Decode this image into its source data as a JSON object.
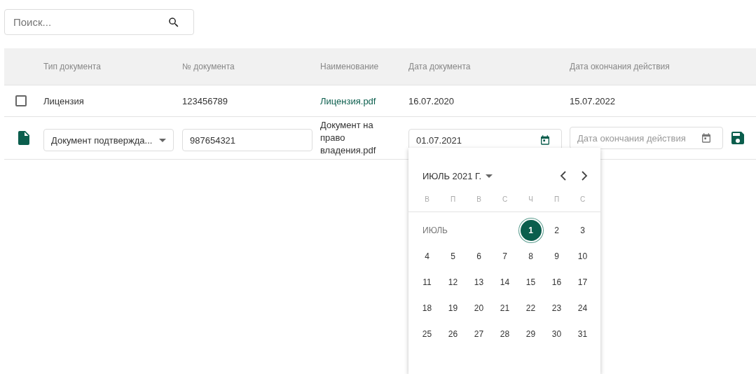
{
  "search": {
    "placeholder": "Поиск..."
  },
  "table": {
    "columns": [
      "Тип документа",
      "№ документа",
      "Наименование",
      "Дата документа",
      "Дата окончания действия"
    ],
    "rows": [
      {
        "kind": "view",
        "checked": false,
        "type": "Лицензия",
        "number": "123456789",
        "name": "Лицензия.pdf",
        "date": "16.07.2020",
        "end_date": "15.07.2022"
      },
      {
        "kind": "edit",
        "type": "Документ подтвержда...",
        "number": "987654321",
        "name": "Документ на право владения.pdf",
        "date": "01.07.2021",
        "end_date_placeholder": "Дата окончания действия"
      }
    ]
  },
  "datepicker": {
    "title": "ИЮЛЬ 2021 Г.",
    "weekdays": [
      "В",
      "П",
      "В",
      "С",
      "Ч",
      "П",
      "С"
    ],
    "weeks": [
      {
        "label": "ИЮЛЬ",
        "days": [
          {
            "day": "1",
            "selected": true
          },
          {
            "day": "2",
            "selected": false
          },
          {
            "day": "3",
            "selected": false
          }
        ]
      },
      {
        "days": [
          {
            "day": "4",
            "selected": false
          },
          {
            "day": "5",
            "selected": false
          },
          {
            "day": "6",
            "selected": false
          },
          {
            "day": "7",
            "selected": false
          },
          {
            "day": "8",
            "selected": false
          },
          {
            "day": "9",
            "selected": false
          },
          {
            "day": "10",
            "selected": false
          }
        ]
      },
      {
        "days": [
          {
            "day": "11",
            "selected": false
          },
          {
            "day": "12",
            "selected": false
          },
          {
            "day": "13",
            "selected": false
          },
          {
            "day": "14",
            "selected": false
          },
          {
            "day": "15",
            "selected": false
          },
          {
            "day": "16",
            "selected": false
          },
          {
            "day": "17",
            "selected": false
          }
        ]
      },
      {
        "days": [
          {
            "day": "18",
            "selected": false
          },
          {
            "day": "19",
            "selected": false
          },
          {
            "day": "20",
            "selected": false
          },
          {
            "day": "21",
            "selected": false
          },
          {
            "day": "22",
            "selected": false
          },
          {
            "day": "23",
            "selected": false
          },
          {
            "day": "24",
            "selected": false
          }
        ]
      },
      {
        "days": [
          {
            "day": "25",
            "selected": false
          },
          {
            "day": "26",
            "selected": false
          },
          {
            "day": "27",
            "selected": false
          },
          {
            "day": "28",
            "selected": false
          },
          {
            "day": "29",
            "selected": false
          },
          {
            "day": "30",
            "selected": false
          },
          {
            "day": "31",
            "selected": false
          }
        ]
      }
    ]
  }
}
